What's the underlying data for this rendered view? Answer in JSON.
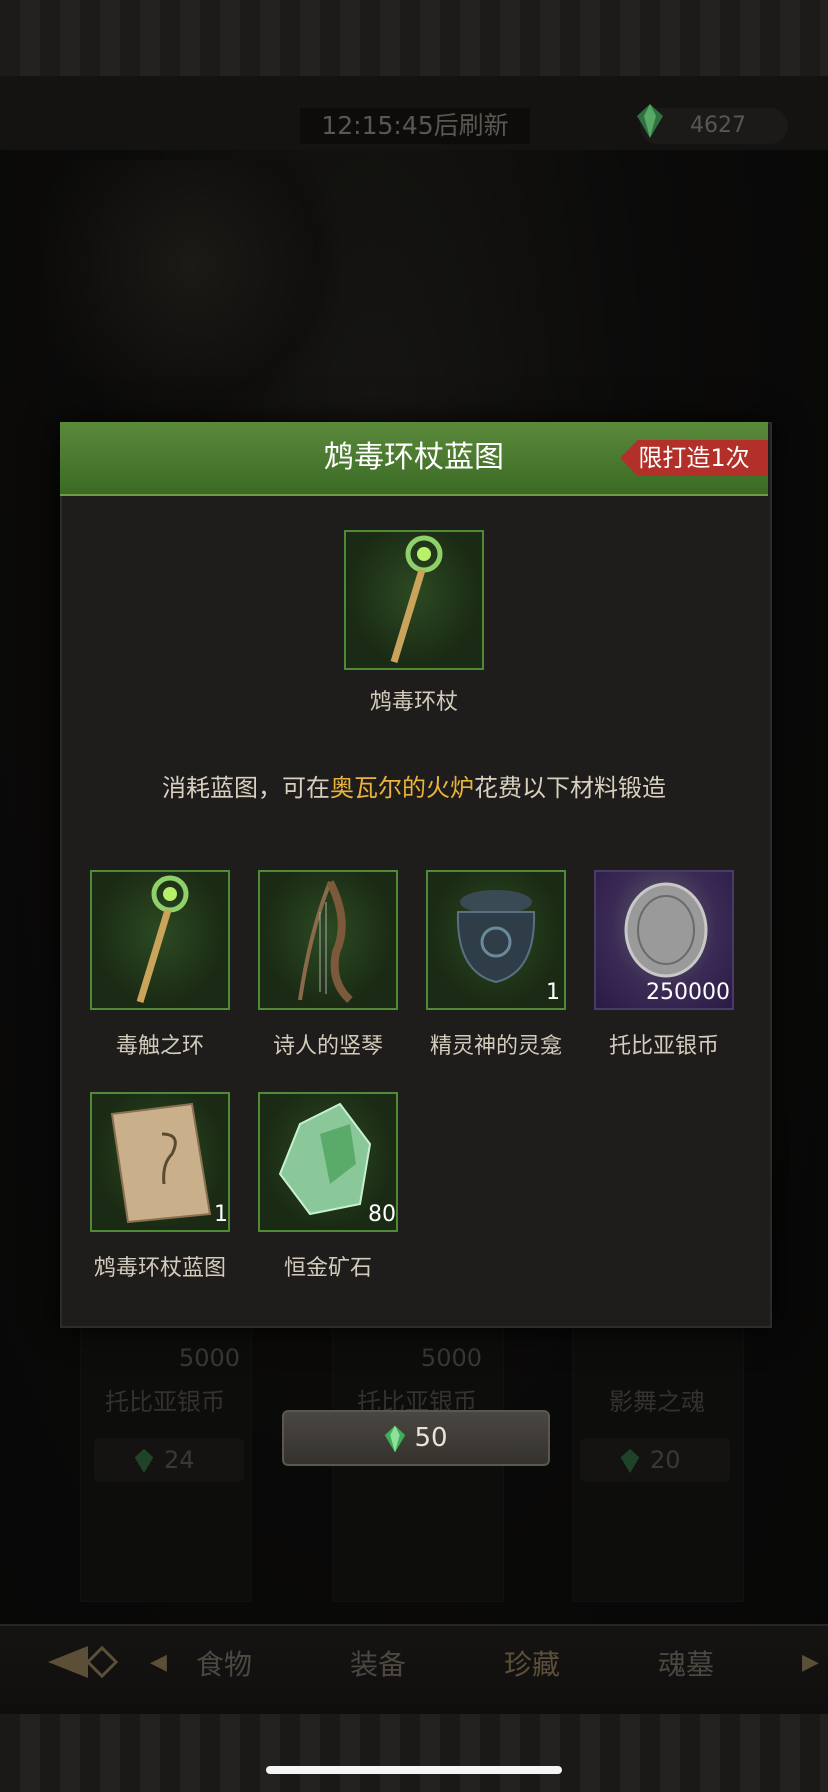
{
  "header": {
    "timer_text": "12:15:45后刷新",
    "gem_count": "4627"
  },
  "modal": {
    "title": "鸩毒环杖蓝图",
    "limit_badge": "限打造1次",
    "result_item": {
      "name": "鸩毒环杖",
      "icon": "staff-icon"
    },
    "desc_prefix": "消耗蓝图，可在",
    "desc_highlight": "奥瓦尔的火炉",
    "desc_suffix": "花费以下材料锻造",
    "materials": [
      {
        "name": "毒触之环",
        "qty": "",
        "icon": "staff-icon"
      },
      {
        "name": "诗人的竖琴",
        "qty": "",
        "icon": "harp-icon"
      },
      {
        "name": "精灵神的灵龛",
        "qty": "1",
        "icon": "urn-icon"
      },
      {
        "name": "托比亚银币",
        "qty": "250000",
        "icon": "coin-icon"
      },
      {
        "name": "鸩毒环杖蓝图",
        "qty": "1",
        "icon": "scroll-icon"
      },
      {
        "name": "恒金矿石",
        "qty": "80",
        "icon": "ore-icon"
      }
    ]
  },
  "background_cards": [
    {
      "value": "5000",
      "name": "托比亚银币",
      "price": "24"
    },
    {
      "value": "5000",
      "name": "托比亚银币",
      "price": ""
    },
    {
      "value": "",
      "name": "影舞之魂",
      "price": "20"
    }
  ],
  "confirm_button": {
    "price": "50"
  },
  "nav": {
    "tabs": [
      "食物",
      "装备",
      "珍藏",
      "魂墓"
    ],
    "active": "珍藏"
  },
  "colors": {
    "accent_green": "#5b8a3c",
    "highlight_gold": "#e8b43a",
    "badge_red": "#b3302a"
  }
}
